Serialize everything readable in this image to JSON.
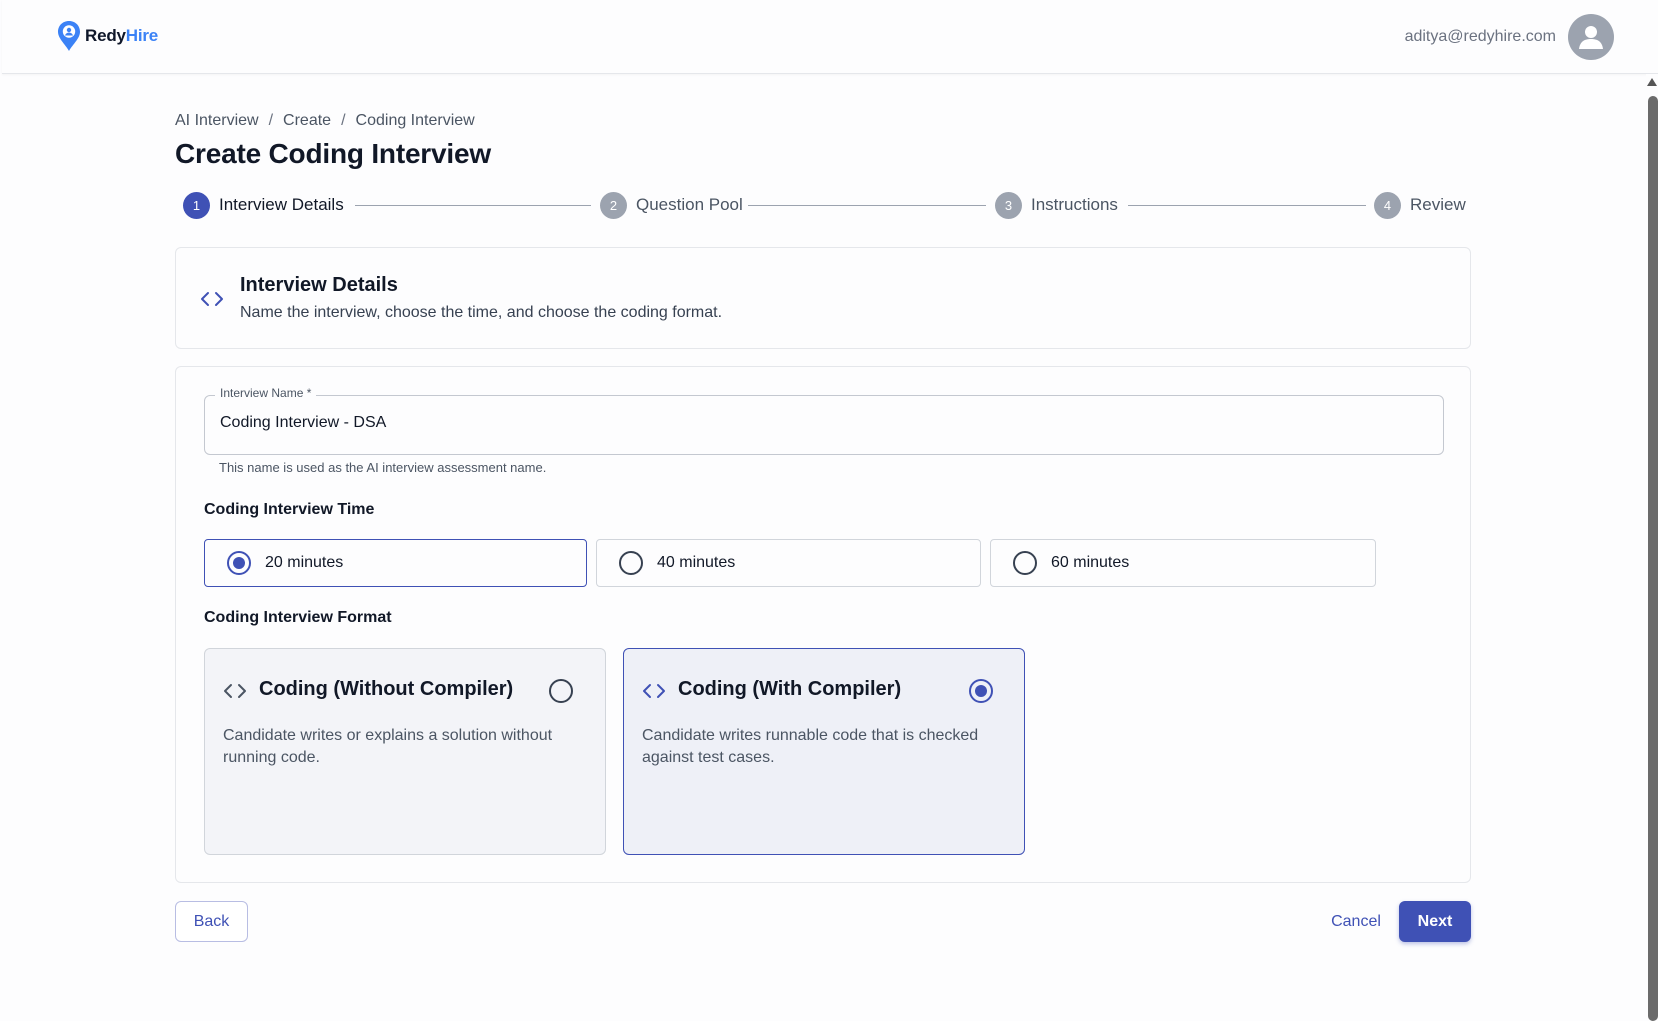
{
  "header": {
    "logo_redy": "Redy",
    "logo_hire": "Hire",
    "user_email": "aditya@redyhire.com"
  },
  "breadcrumb": [
    "AI Interview",
    "Create",
    "Coding Interview"
  ],
  "breadcrumb_sep": "/",
  "page_title": "Create Coding Interview",
  "steps": [
    {
      "num": "1",
      "label": "Interview Details",
      "active": true
    },
    {
      "num": "2",
      "label": "Question Pool",
      "active": false
    },
    {
      "num": "3",
      "label": "Instructions",
      "active": false
    },
    {
      "num": "4",
      "label": "Review",
      "active": false
    }
  ],
  "details_card": {
    "title": "Interview Details",
    "subtitle": "Name the interview, choose the time, and choose the coding format."
  },
  "form": {
    "name_label": "Interview Name *",
    "name_value": "Coding Interview - DSA",
    "name_help": "This name is used as the AI interview assessment name.",
    "time_label": "Coding Interview Time",
    "time_options": [
      "20 minutes",
      "40 minutes",
      "60 minutes"
    ],
    "time_selected": "20 minutes",
    "format_label": "Coding Interview Format",
    "formats": [
      {
        "title": "Coding (Without Compiler)",
        "desc": "Candidate writes or explains a solution without running code.",
        "selected": false
      },
      {
        "title": "Coding (With Compiler)",
        "desc": "Candidate writes runnable code that is checked against test cases.",
        "selected": true
      }
    ]
  },
  "actions": {
    "back": "Back",
    "cancel": "Cancel",
    "next": "Next"
  },
  "colors": {
    "accent": "#3f51b5",
    "brand_blue": "#3b82f6"
  }
}
